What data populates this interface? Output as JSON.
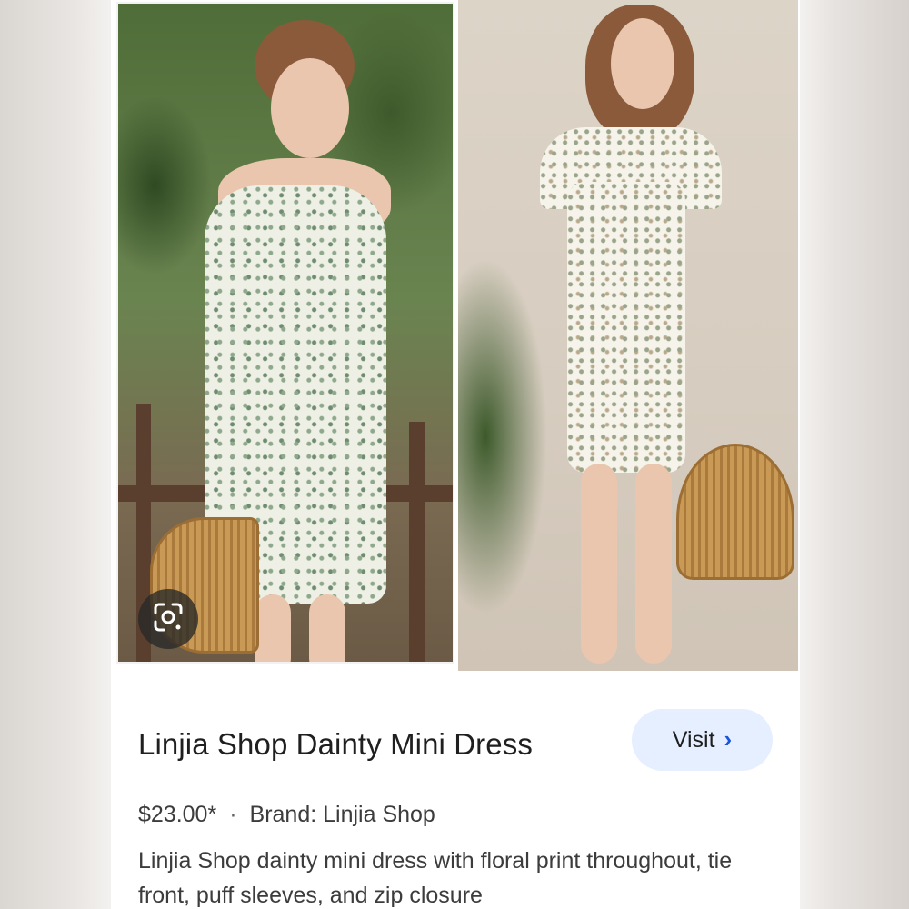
{
  "product": {
    "title": "Linjia Shop Dainty Mini Dress",
    "price": "$23.00*",
    "separator": "·",
    "brand": "Brand: Linjia Shop",
    "description": "Linjia Shop dainty mini dress with floral print throughout, tie front, puff sleeves, and zip closure"
  },
  "visit_button": {
    "label": "Visit",
    "chevron": "›"
  },
  "icons": {
    "lens": "google-lens-icon",
    "chevron": "chevron-right-icon"
  },
  "colors": {
    "visit_bg": "#e6efff",
    "chevron": "#1a56d8",
    "title_text": "#1f1f1f"
  }
}
